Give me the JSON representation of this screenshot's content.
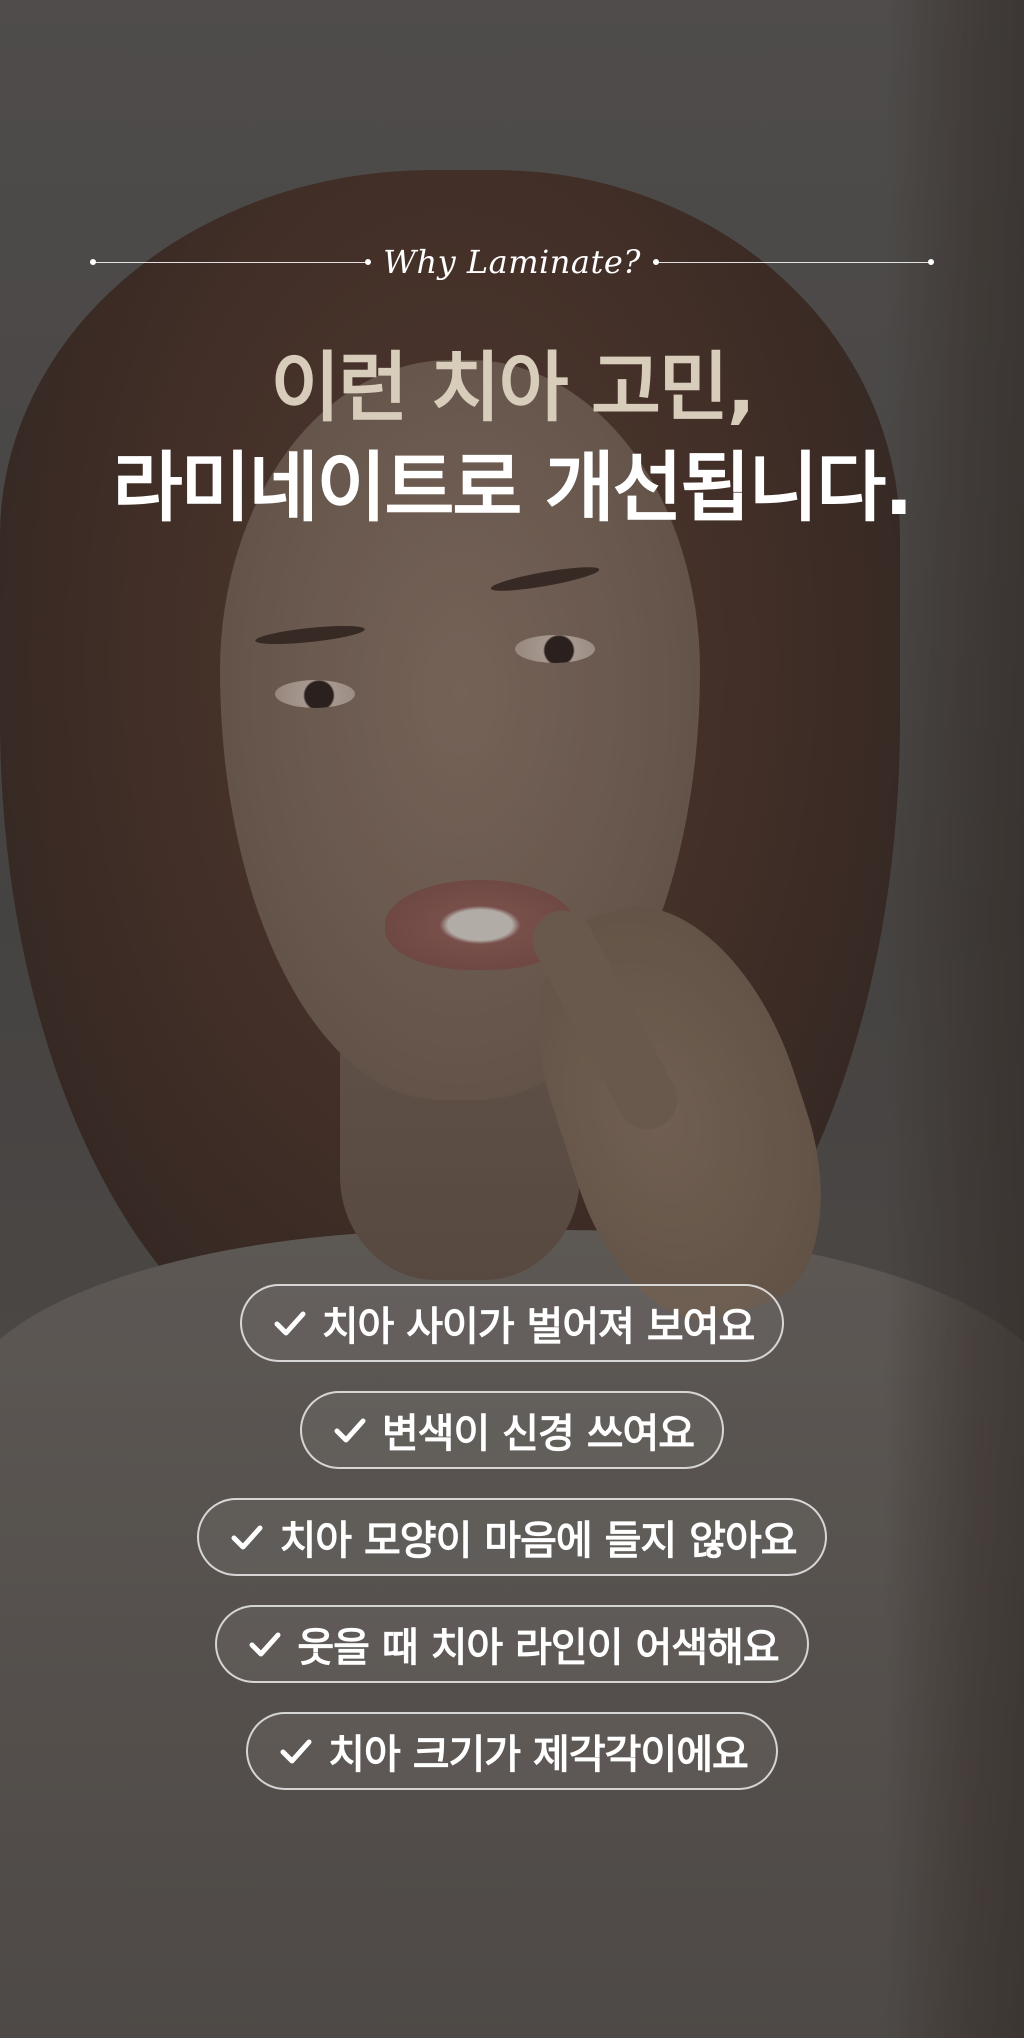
{
  "eyebrow": "Why Laminate?",
  "headline": {
    "line1": "이런 치아 고민,",
    "line2": "라미네이트로 개선됩니다."
  },
  "concerns": [
    {
      "icon": "check-icon",
      "label": "치아 사이가 벌어져 보여요"
    },
    {
      "icon": "check-icon",
      "label": "변색이 신경 쓰여요"
    },
    {
      "icon": "check-icon",
      "label": "치아 모양이 마음에 들지 않아요"
    },
    {
      "icon": "check-icon",
      "label": "웃을 때 치아 라인이 어색해요"
    },
    {
      "icon": "check-icon",
      "label": "치아 크기가 제각각이에요"
    }
  ],
  "colors": {
    "headline_accent": "#d8cdbb",
    "text": "#ffffff"
  }
}
